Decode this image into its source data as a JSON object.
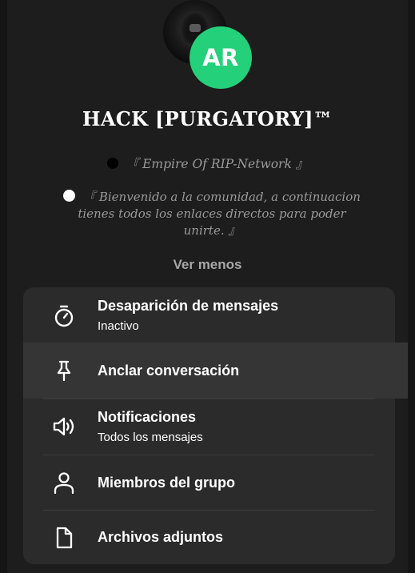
{
  "group": {
    "name": "HACK [PURGATORY]™",
    "avatar_initials": "AR",
    "avatar_color": "#25d07a",
    "description_line1": "『 Empire Of RIP-Network 』",
    "description_line2": "『 Bienvenido a la comunidad, a continuacion tienes todos los enlaces directos para poder unirte. 』",
    "show_less_label": "Ver menos"
  },
  "menu": [
    {
      "icon": "timer-icon",
      "label": "Desaparición de mensajes",
      "sublabel": "Inactivo"
    },
    {
      "icon": "pin-icon",
      "label": "Anclar conversación"
    },
    {
      "icon": "speaker-icon",
      "label": "Notificaciones",
      "sublabel": "Todos los mensajes"
    },
    {
      "icon": "person-icon",
      "label": "Miembros del grupo"
    },
    {
      "icon": "file-icon",
      "label": "Archivos adjuntos"
    }
  ]
}
